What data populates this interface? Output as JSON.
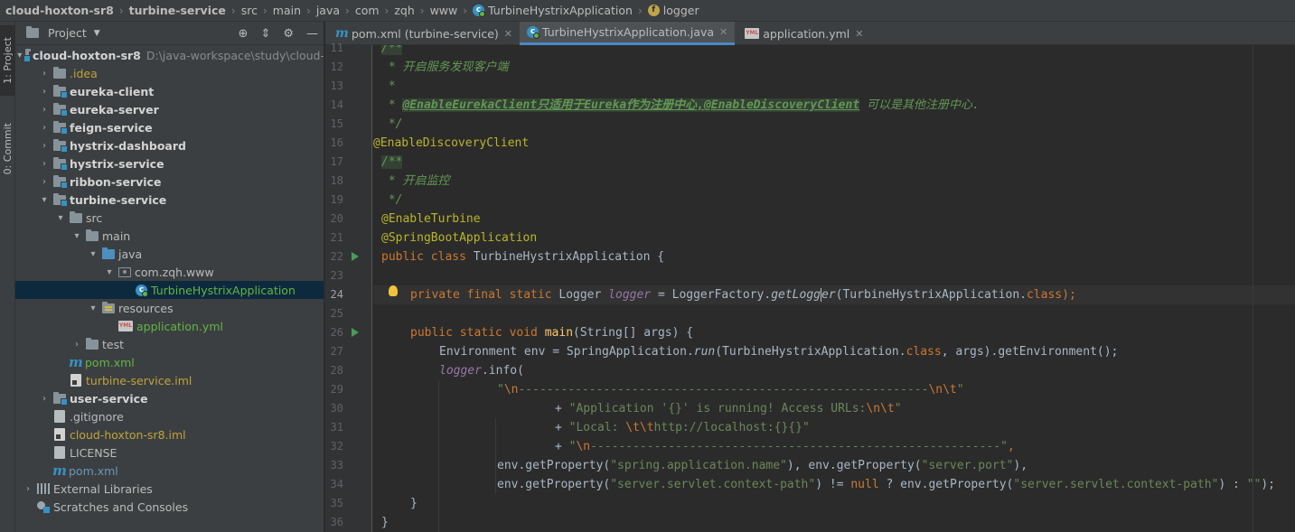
{
  "breadcrumb": [
    "cloud-hoxton-sr8",
    "turbine-service",
    "src",
    "main",
    "java",
    "com",
    "zqh",
    "www",
    "TurbineHystrixApplication",
    "logger"
  ],
  "tool_strip": {
    "project_tab": "1: Project",
    "commit_tab": "0: Commit"
  },
  "project_panel": {
    "title": "Project",
    "tree": [
      {
        "label": "cloud-hoxton-sr8",
        "path": "D:\\java-workspace\\study\\cloud-"
      },
      {
        "label": ".idea"
      },
      {
        "label": "eureka-client"
      },
      {
        "label": "eureka-server"
      },
      {
        "label": "feign-service"
      },
      {
        "label": "hystrix-dashboard"
      },
      {
        "label": "hystrix-service"
      },
      {
        "label": "ribbon-service"
      },
      {
        "label": "turbine-service"
      },
      {
        "label": "src"
      },
      {
        "label": "main"
      },
      {
        "label": "java"
      },
      {
        "label": "com.zqh.www"
      },
      {
        "label": "TurbineHystrixApplication"
      },
      {
        "label": "resources"
      },
      {
        "label": "application.yml"
      },
      {
        "label": "test"
      },
      {
        "label": "pom.xml"
      },
      {
        "label": "turbine-service.iml"
      },
      {
        "label": "user-service"
      },
      {
        "label": ".gitignore"
      },
      {
        "label": "cloud-hoxton-sr8.iml"
      },
      {
        "label": "LICENSE"
      },
      {
        "label": "pom.xml"
      },
      {
        "label": "External Libraries"
      },
      {
        "label": "Scratches and Consoles"
      }
    ]
  },
  "editor_tabs": [
    {
      "label": "pom.xml (turbine-service)"
    },
    {
      "label": "TurbineHystrixApplication.java"
    },
    {
      "label": "application.yml"
    }
  ],
  "line_numbers": [
    "11",
    "12",
    "13",
    "14",
    "15",
    "16",
    "17",
    "18",
    "19",
    "20",
    "21",
    "22",
    "23",
    "24",
    "25",
    "26",
    "27",
    "28",
    "29",
    "30",
    "31",
    "32",
    "33",
    "34",
    "35",
    "36"
  ],
  "code": {
    "l11": "/**",
    "l12": " * 开启服务发现客户端",
    "l13": " *",
    "l14a": " * ",
    "l14b": "@EnableEurekaClient只适用于Eureka作为注册中心,@EnableDiscoveryClient",
    "l14c": " 可以是其他注册中心.",
    "l15": " */",
    "l16": "@EnableDiscoveryClient",
    "l17": "/**",
    "l18": " * 开启监控",
    "l19": " */",
    "l20": "@EnableTurbine",
    "l21": "@SpringBootApplication",
    "l22a": "public class ",
    "l22b": "TurbineHystrixApplication {",
    "l23": "",
    "l24a": "private final static ",
    "l24b": "Logger ",
    "l24c": "logger",
    "l24d": " = LoggerFactory.",
    "l24e": "getLogg",
    "l24f": "er",
    "l24g": "(TurbineHystrixApplication.",
    "l24h": "class",
    "l24i": ");",
    "l25": "",
    "l26a": "public static void ",
    "l26b": "main",
    "l26c": "(String[] args) {",
    "l27a": "Environment env = SpringApplication.",
    "l27b": "run",
    "l27c": "(TurbineHystrixApplication.",
    "l27d": "class",
    "l27e": ", args).getEnvironment();",
    "l28a": "logger",
    "l28b": ".info(",
    "l29a": "\"",
    "l29b": "\\n",
    "l29c": "----------------------------------------------------------",
    "l29d": "\\n\\t",
    "l29e": "\"",
    "l30a": "+ ",
    "l30b": "\"Application '{}' is running! Access URLs:",
    "l30c": "\\n\\t",
    "l30d": "\"",
    "l31a": "+ ",
    "l31b": "\"Local: ",
    "l31c": "\\t\\t",
    "l31d": "http://localhost:{}{}\"",
    "l32a": "+ ",
    "l32b": "\"",
    "l32c": "\\n",
    "l32d": "----------------------------------------------------------\"",
    "l32e": ",",
    "l33a": "env.getProperty(",
    "l33b": "\"spring.application.name\"",
    "l33c": "), env.getProperty(",
    "l33d": "\"server.port\"",
    "l33e": "),",
    "l34a": "env.getProperty(",
    "l34b": "\"server.servlet.context-path\"",
    "l34c": ") != ",
    "l34d": "null",
    "l34e": " ? env.getProperty(",
    "l34f": "\"server.servlet.context-path\"",
    "l34g": ") : ",
    "l34h": "\"\"",
    "l34i": ");",
    "l35": "}",
    "l36": "}"
  }
}
